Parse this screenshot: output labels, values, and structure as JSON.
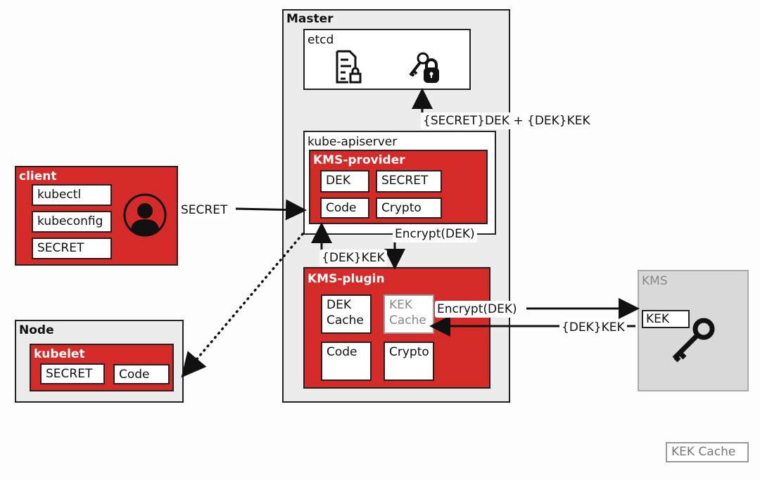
{
  "master": {
    "title": "Master",
    "etcd": {
      "title": "etcd",
      "icons": [
        "encrypted-document-icon",
        "key-lock-icon"
      ]
    },
    "arrow_to_etcd_label": "{SECRET}DEK + {DEK}KEK",
    "apiserver": {
      "title": "kube-apiserver",
      "kms_provider": {
        "title": "KMS-provider",
        "cells": [
          "DEK",
          "SECRET",
          "Code",
          "Crypto"
        ]
      }
    },
    "encrypt_label": "Encrypt(DEK)",
    "dek_kek_label": "{DEK}KEK",
    "kms_plugin": {
      "title": "KMS-plugin",
      "dek_cache": [
        "DEK",
        "Cache"
      ],
      "kek_cache": [
        "KEK",
        "Cache"
      ],
      "code": "Code",
      "crypto": "Crypto"
    }
  },
  "client": {
    "title": "client",
    "items": [
      "kubectl",
      "kubeconfig",
      "SECRET"
    ],
    "icon": "user-icon"
  },
  "client_arrow_label": "SECRET",
  "node": {
    "title": "Node",
    "kubelet": {
      "title": "kubelet",
      "items": [
        "SECRET",
        "Code"
      ]
    }
  },
  "kms": {
    "title": "KMS",
    "kek": "KEK",
    "icon": "key-icon",
    "encrypt_label": "Encrypt(DEK)",
    "return_label": "{DEK}KEK"
  },
  "legend": {
    "label": "KEK Cache"
  },
  "colors": {
    "red": "#d42a28",
    "gray": "#ececec",
    "kms_gray": "#d9d9d9"
  }
}
